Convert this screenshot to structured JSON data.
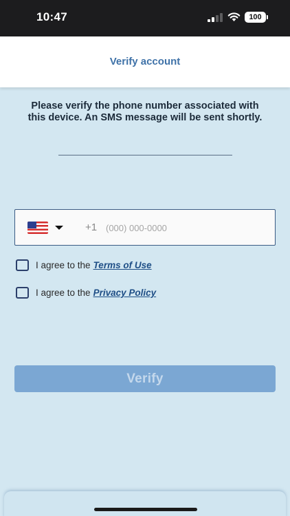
{
  "status_bar": {
    "time": "10:47",
    "battery": "100"
  },
  "header": {
    "title": "Verify account"
  },
  "instructions": "Please verify the phone number associated with this device. An SMS message will be sent shortly.",
  "phone": {
    "country_code": "+1",
    "placeholder": "(000) 000-0000",
    "value": "",
    "country_flag": "us-flag-icon"
  },
  "agreements": {
    "terms_prefix": "I agree to the",
    "terms_link": "Terms of Use",
    "terms_checked": false,
    "privacy_prefix": "I agree to the",
    "privacy_link": "Privacy Policy",
    "privacy_checked": false
  },
  "verify_button": {
    "label": "Verify",
    "disabled": true
  },
  "colors": {
    "background": "#d3e7f1",
    "accent": "#3f72a8",
    "button": "#7ba7d3",
    "link": "#1e4e86"
  }
}
